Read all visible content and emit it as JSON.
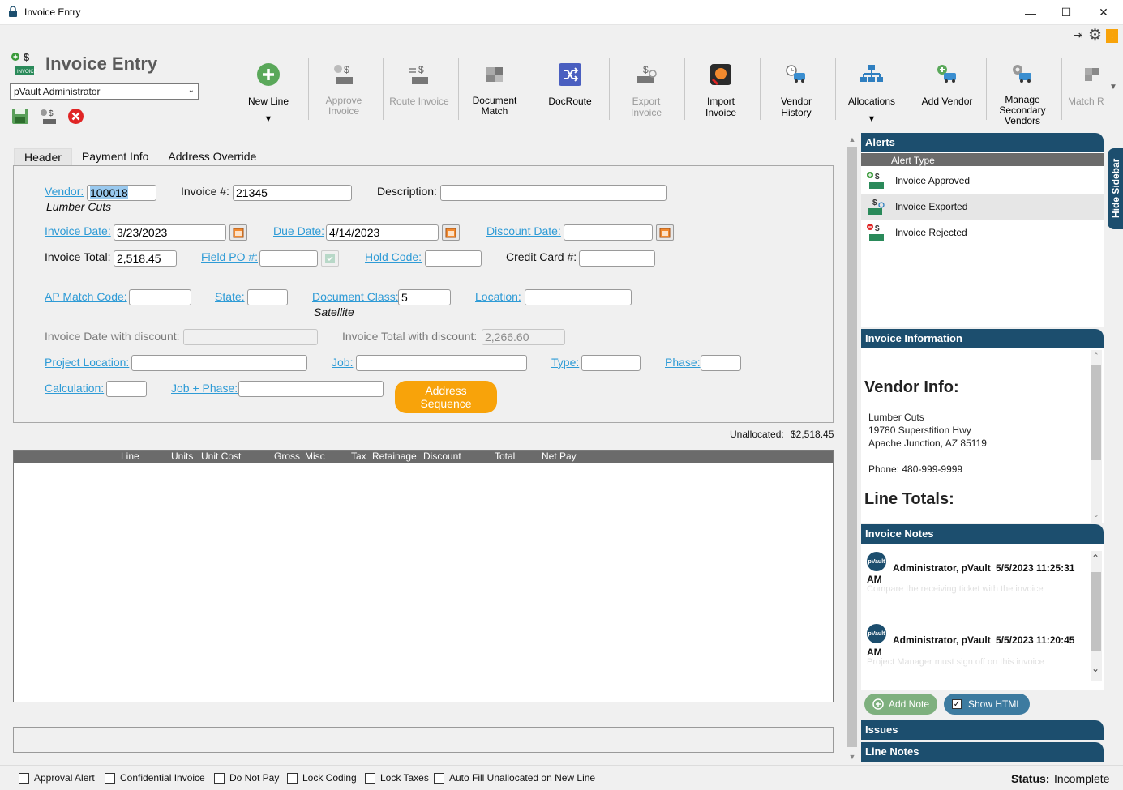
{
  "window": {
    "title": "Invoice Entry",
    "controls": {
      "minimize": "—",
      "maximize": "☐",
      "close": "✕"
    }
  },
  "app": {
    "title": "Invoice Entry",
    "user_select": {
      "value": "pVault Administrator"
    }
  },
  "toolbar": {
    "buttons": [
      {
        "label": "New Line",
        "enabled": true,
        "has_dropdown": true
      },
      {
        "label": "Approve Invoice",
        "enabled": false
      },
      {
        "label": "Route Invoice",
        "enabled": false
      },
      {
        "label": "Document Match",
        "enabled": true
      },
      {
        "label": "DocRoute",
        "enabled": true
      },
      {
        "label": "Export Invoice",
        "enabled": false
      },
      {
        "label": "Import Invoice",
        "enabled": true
      },
      {
        "label": "Vendor History",
        "enabled": true
      },
      {
        "label": "Allocations",
        "enabled": true,
        "has_dropdown": true
      },
      {
        "label": "Add Vendor",
        "enabled": true
      },
      {
        "label": "Manage Secondary Vendors",
        "enabled": true
      },
      {
        "label": "Match R",
        "enabled": false
      }
    ]
  },
  "tabs": [
    {
      "label": "Header",
      "active": true
    },
    {
      "label": "Payment Info",
      "active": false
    },
    {
      "label": "Address Override",
      "active": false
    }
  ],
  "form": {
    "vendor": {
      "label": "Vendor:",
      "value": "100018",
      "name": "Lumber Cuts"
    },
    "invoice_no": {
      "label": "Invoice #:",
      "value": "21345"
    },
    "description": {
      "label": "Description:",
      "value": ""
    },
    "invoice_date": {
      "label": "Invoice Date:",
      "value": "3/23/2023"
    },
    "due_date": {
      "label": "Due Date:",
      "value": "4/14/2023"
    },
    "discount_date": {
      "label": "Discount Date:",
      "value": ""
    },
    "invoice_total": {
      "label": "Invoice Total:",
      "value": "2,518.45"
    },
    "field_po": {
      "label": "Field PO #:",
      "value": ""
    },
    "hold_code": {
      "label": "Hold Code:",
      "value": ""
    },
    "credit_card": {
      "label": "Credit Card #:",
      "value": ""
    },
    "ap_match_code": {
      "label": "AP Match Code:",
      "value": ""
    },
    "state": {
      "label": "State:",
      "value": ""
    },
    "document_class": {
      "label": "Document Class:",
      "value": "5",
      "name": "Satellite"
    },
    "location": {
      "label": "Location:",
      "value": ""
    },
    "invoice_date_discount": {
      "label": "Invoice Date with discount:",
      "value": ""
    },
    "invoice_total_discount": {
      "label": "Invoice Total with discount:",
      "value": "2,266.60"
    },
    "project_location": {
      "label": "Project Location:",
      "value": ""
    },
    "job": {
      "label": "Job:",
      "value": ""
    },
    "type": {
      "label": "Type:",
      "value": ""
    },
    "phase": {
      "label": "Phase:",
      "value": ""
    },
    "calculation": {
      "label": "Calculation:",
      "value": ""
    },
    "job_phase": {
      "label": "Job + Phase:",
      "value": ""
    },
    "address_sequence_button": "Address Sequence"
  },
  "unallocated": {
    "label": "Unallocated:",
    "value": "$2,518.45"
  },
  "grid": {
    "columns": [
      "Line",
      "Units",
      "Unit Cost",
      "Gross",
      "Misc",
      "Tax",
      "Retainage",
      "Discount",
      "Total",
      "Net Pay"
    ],
    "rows": []
  },
  "sidebar": {
    "hide_label": "Hide Sidebar",
    "alerts": {
      "title": "Alerts",
      "column": "Alert Type",
      "items": [
        {
          "label": "Invoice Approved",
          "icon": "invoice-approved-icon"
        },
        {
          "label": "Invoice Exported",
          "icon": "invoice-exported-icon",
          "selected": true
        },
        {
          "label": "Invoice Rejected",
          "icon": "invoice-rejected-icon"
        }
      ]
    },
    "invoice_info": {
      "title": "Invoice Information",
      "vendor_heading": "Vendor Info:",
      "vendor_name": "Lumber Cuts",
      "address1": "19780 Superstition Hwy",
      "address2": "Apache Junction, AZ 85119",
      "phone": "Phone: 480-999-9999",
      "line_totals_heading": "Line Totals:"
    },
    "notes": {
      "title": "Invoice Notes",
      "items": [
        {
          "avatar": "pVault",
          "author": "Administrator, pVault",
          "date": "5/5/2023 11:25:31",
          "ampm": "AM",
          "text": "Compare the receiving ticket with the invoice"
        },
        {
          "avatar": "pVault",
          "author": "Administrator, pVault",
          "date": "5/5/2023 11:20:45",
          "ampm": "AM",
          "text": "Project Manager must sign off on this invoice"
        }
      ],
      "add_note": "Add Note",
      "show_html": "Show HTML",
      "show_html_checked": true
    },
    "issues_title": "Issues",
    "line_notes_title": "Line Notes"
  },
  "bottom": {
    "checkboxes": [
      {
        "label": "Approval Alert",
        "checked": false
      },
      {
        "label": "Confidential Invoice",
        "checked": false
      },
      {
        "label": "Do Not Pay",
        "checked": false
      },
      {
        "label": "Lock Coding",
        "checked": false
      },
      {
        "label": "Lock Taxes",
        "checked": false
      },
      {
        "label": "Auto Fill Unallocated on New Line",
        "checked": false
      }
    ],
    "status_label": "Status:",
    "status_value": "Incomplete"
  },
  "colors": {
    "accent_navy": "#1c4e6e",
    "link_blue": "#2e9bd6",
    "orange": "#f8a30a",
    "green_pill": "#7eb07e"
  }
}
